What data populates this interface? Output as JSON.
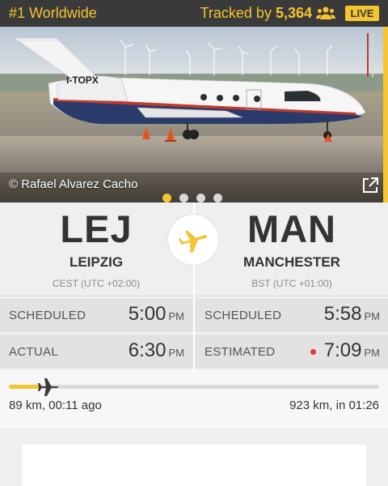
{
  "header": {
    "rank": "#1 Worldwide",
    "tracked_prefix": "Tracked by ",
    "tracked_count": "5,364",
    "live_badge": "LIVE"
  },
  "photo": {
    "credit": "© Rafael Alvarez Cacho",
    "registration": "I-TOPX",
    "slides": 4,
    "active_slide": 1
  },
  "origin": {
    "code": "LEJ",
    "city": "LEIPZIG",
    "timezone": "CEST (UTC +02:00)"
  },
  "destination": {
    "code": "MAN",
    "city": "MANCHESTER",
    "timezone": "BST (UTC +01:00)"
  },
  "times": {
    "origin_scheduled_label": "SCHEDULED",
    "origin_scheduled_time": "5:00",
    "origin_scheduled_ampm": "PM",
    "origin_actual_label": "ACTUAL",
    "origin_actual_time": "6:30",
    "origin_actual_ampm": "PM",
    "dest_scheduled_label": "SCHEDULED",
    "dest_scheduled_time": "5:58",
    "dest_scheduled_ampm": "PM",
    "dest_estimated_label": "ESTIMATED",
    "dest_estimated_time": "7:09",
    "dest_estimated_ampm": "PM"
  },
  "progress": {
    "elapsed": "89 km, 00:11 ago",
    "remaining": "923 km, in 01:26",
    "fraction": 0.088
  },
  "colors": {
    "accent": "#f3c531",
    "header_bg": "#3a3a3a",
    "status_dot": "#e0393b"
  }
}
